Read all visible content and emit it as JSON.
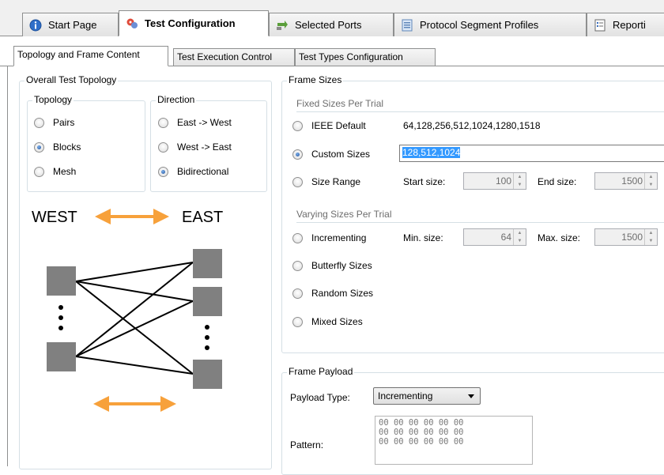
{
  "main_tabs": [
    {
      "label": "Start Page",
      "icon": "info-icon"
    },
    {
      "label": "Test Configuration",
      "icon": "configuration-icon"
    },
    {
      "label": "Selected Ports",
      "icon": "ports-icon"
    },
    {
      "label": "Protocol Segment Profiles",
      "icon": "profile-icon"
    },
    {
      "label": "Reporti",
      "icon": "report-icon"
    }
  ],
  "sub_tabs": [
    {
      "label": "Topology and Frame Content"
    },
    {
      "label": "Test Execution Control"
    },
    {
      "label": "Test Types Configuration"
    }
  ],
  "topology": {
    "title": "Overall Test Topology",
    "topology_group": {
      "title": "Topology",
      "options": [
        "Pairs",
        "Blocks",
        "Mesh"
      ],
      "selected": "Blocks"
    },
    "direction_group": {
      "title": "Direction",
      "options": [
        "East -> West",
        "West -> East",
        "Bidirectional"
      ],
      "selected": "Bidirectional"
    },
    "diagram": {
      "west_label": "WEST",
      "east_label": "EAST",
      "arrow_color": "#f7a13b",
      "node_color": "#808080"
    }
  },
  "frame_sizes": {
    "title": "Frame Sizes",
    "fixed_header": "Fixed Sizes Per Trial",
    "ieee_label": "IEEE Default",
    "ieee_values": "64,128,256,512,1024,1280,1518",
    "custom_label": "Custom Sizes",
    "custom_value": "128,512,1024",
    "range_label": "Size Range",
    "start_label": "Start size:",
    "start_value": "100",
    "end_label": "End size:",
    "end_value": "1500",
    "varying_header": "Varying Sizes Per Trial",
    "incrementing_label": "Incrementing",
    "min_label": "Min. size:",
    "min_value": "64",
    "max_label": "Max. size:",
    "max_value": "1500",
    "butterfly_label": "Butterfly Sizes",
    "random_label": "Random Sizes",
    "mixed_label": "Mixed Sizes",
    "selected": "Custom Sizes"
  },
  "frame_payload": {
    "title": "Frame Payload",
    "type_label": "Payload Type:",
    "type_value": "Incrementing",
    "pattern_label": "Pattern:",
    "pattern_rows": [
      "00 00 00 00 00 00",
      "00 00 00 00 00 00",
      "00 00 00 00 00 00"
    ]
  }
}
